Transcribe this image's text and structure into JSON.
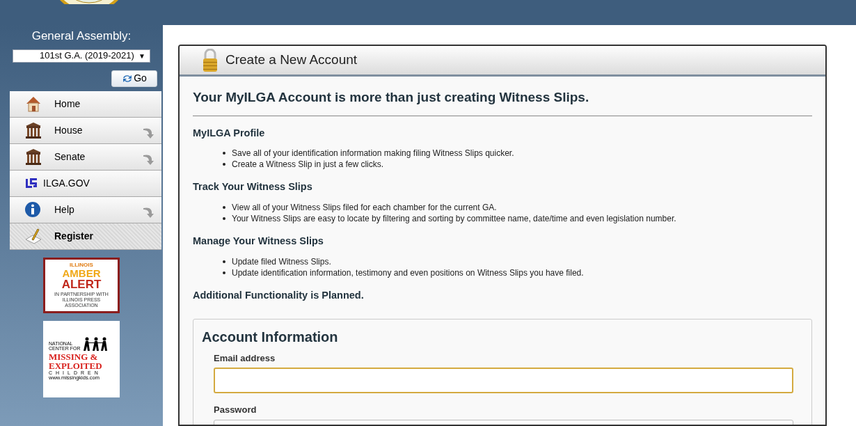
{
  "sidebar": {
    "assembly_label": "General Assembly:",
    "assembly_select": {
      "value": "101st G.A. (2019-2021)",
      "arrow": "▼"
    },
    "go_button": "Go",
    "nav": [
      {
        "label": "Home",
        "kind": "home",
        "has_submenu": false,
        "selected": false
      },
      {
        "label": "House",
        "kind": "building",
        "has_submenu": true,
        "selected": false
      },
      {
        "label": "Senate",
        "kind": "building",
        "has_submenu": true,
        "selected": false
      },
      {
        "label": "ILGA.GOV",
        "kind": "logo",
        "has_submenu": false,
        "selected": false
      },
      {
        "label": "Help",
        "kind": "info",
        "has_submenu": true,
        "selected": false
      },
      {
        "label": "Register",
        "kind": "pencil",
        "has_submenu": false,
        "selected": true
      }
    ],
    "amber_alert": {
      "line_1": "ILLINOIS",
      "line_2": "AMBER",
      "line_3": "ALERT",
      "footer": "IN PARTNERSHIP WITH ILLINOIS PRESS ASSOCIATION"
    },
    "missing_kids": {
      "line_1": "NATIONAL",
      "line_2": "CENTER FOR",
      "line_3": "MISSING &",
      "line_4": "EXPLOITED",
      "line_5": "CHILDREN",
      "url": "www.missingkids.com"
    }
  },
  "panel": {
    "title": "Create a New Account",
    "heading": "Your MyILGA Account is more than just creating Witness Slips.",
    "sections": [
      {
        "title": "MyILGA Profile",
        "bullets": [
          "Save all of your identification information making filing Witness Slips quicker.",
          "Create a Witness Slip in just a few clicks."
        ]
      },
      {
        "title": "Track Your Witness Slips",
        "bullets": [
          "View all of your Witness Slips filed for each chamber for the current GA.",
          "Your Witness Slips are easy to locate by filtering and sorting by committee name, date/time and even legislation number."
        ]
      },
      {
        "title": "Manage Your Witness Slips",
        "bullets": [
          "Update filed Witness Slips.",
          "Update identification information, testimony and even positions on Witness Slips you have filed."
        ]
      },
      {
        "title": "Additional Functionality is Planned."
      }
    ],
    "form": {
      "title": "Account Information",
      "fields": [
        {
          "label": "Email address",
          "focused": true
        },
        {
          "label": "Password",
          "focused": false
        }
      ]
    }
  }
}
